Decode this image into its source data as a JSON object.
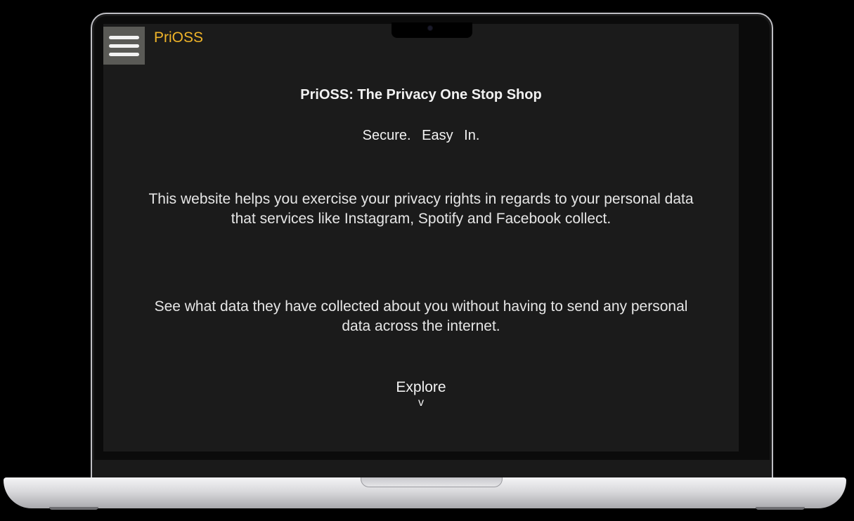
{
  "app": {
    "brand": "PriOSS"
  },
  "header": {
    "menu_icon": "hamburger-menu-icon"
  },
  "main": {
    "title": "PriOSS: The Privacy One Stop Shop",
    "tagline": [
      "Secure.",
      "Easy",
      "In."
    ],
    "paragraph1": "This website helps you exercise your privacy rights in regards to your personal data that services like Instagram, Spotify and Facebook collect.",
    "paragraph2": "See what data they have collected about you without having to send any personal data across the internet.",
    "explore_label": "Explore",
    "explore_chevron": "v"
  },
  "colors": {
    "background": "#1b1b1b",
    "brand": "#f0b429",
    "text": "#f2f2f2",
    "menu_button": "#5a5a56"
  }
}
